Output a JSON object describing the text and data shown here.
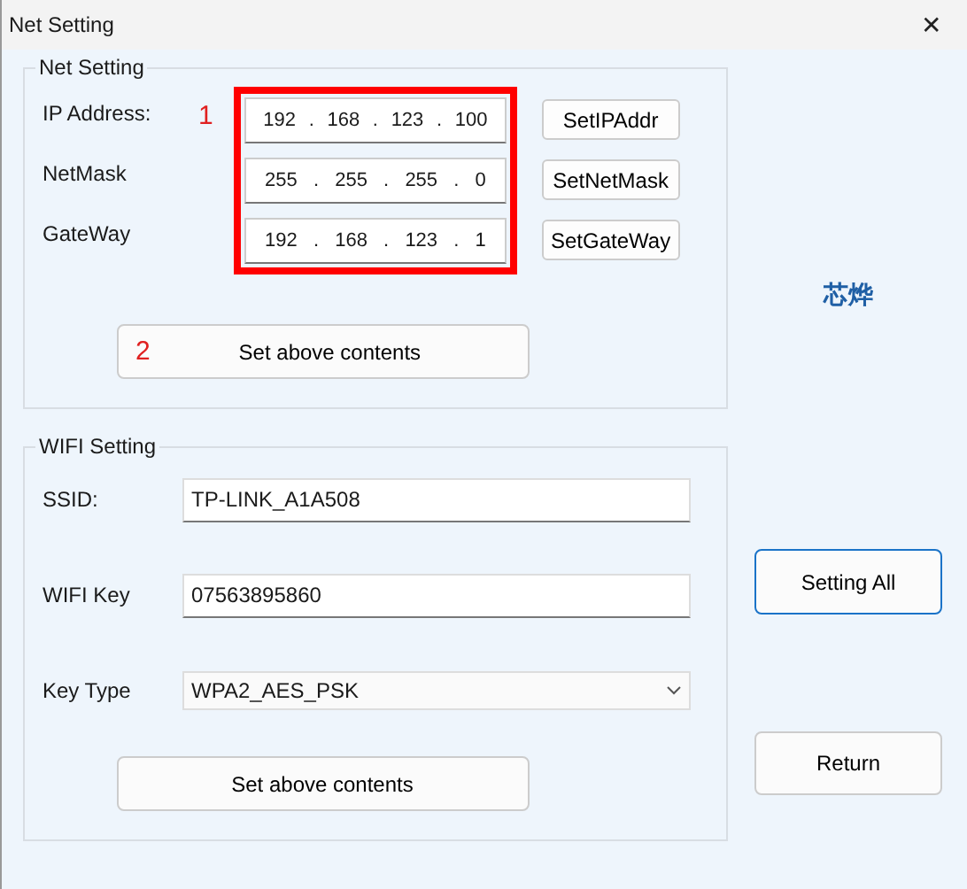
{
  "window": {
    "title": "Net Setting",
    "close": "✕"
  },
  "net_setting": {
    "title": "Net Setting",
    "marker": "1",
    "rows": [
      {
        "label": "IP Address:",
        "octets": [
          "192",
          "168",
          "123",
          "100"
        ],
        "separator": ".",
        "button": "SetIPAddr"
      },
      {
        "label": "NetMask",
        "octets": [
          "255",
          "255",
          "255",
          "0"
        ],
        "separator": ".",
        "button": "SetNetMask"
      },
      {
        "label": "GateWay",
        "octets": [
          "192",
          "168",
          "123",
          "1"
        ],
        "separator": ".",
        "button": "SetGateWay"
      }
    ],
    "apply_marker": "2",
    "apply": "Set above contents"
  },
  "logo": "芯烨",
  "wifi_setting": {
    "title": "WIFI Setting",
    "fields": [
      {
        "kind": "text",
        "label": "SSID:",
        "value": "TP-LINK_A1A508"
      },
      {
        "kind": "text",
        "label": "WIFI Key",
        "value": "07563895860"
      },
      {
        "kind": "select",
        "label": "Key Type",
        "value": "WPA2_AES_PSK"
      }
    ],
    "apply": "Set above contents"
  },
  "buttons": [
    {
      "label": "Setting All",
      "focused": true
    },
    {
      "label": "Return",
      "focused": false
    }
  ]
}
